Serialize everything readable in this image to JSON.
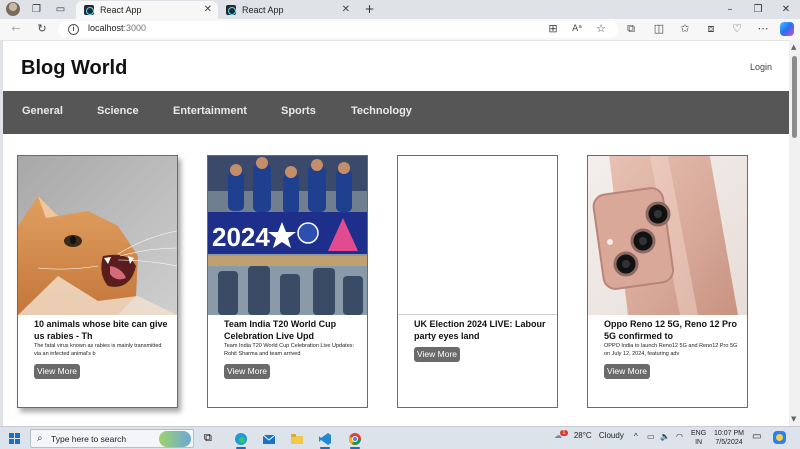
{
  "browser": {
    "tabs": [
      {
        "label": "React App",
        "active": true
      },
      {
        "label": "React App",
        "active": false
      }
    ],
    "address": {
      "host": "localhost",
      "port": ":3000"
    }
  },
  "site": {
    "brand": "Blog World",
    "login_label": "Login",
    "categories": [
      "General",
      "Science",
      "Entertainment",
      "Sports",
      "Technology"
    ],
    "cards": [
      {
        "title": "10 animals whose bite can give us rabies - Th",
        "description": "The fatal virus known as rabies is mainly transmitted via an infected animal's b",
        "button": "View More",
        "image": "cat-photo"
      },
      {
        "title": "Team India T20 World Cup Celebration Live Upd",
        "description": "Team India T20 World Cup Celebration Live Updates: Rohit Sharma and team arrived",
        "button": "View More",
        "image": "cricket-team-bus-photo",
        "banner_text": "2024"
      },
      {
        "title": "UK Election 2024 LIVE: Labour party eyes land",
        "description": "",
        "button": "View More",
        "image": ""
      },
      {
        "title": "Oppo Reno 12 5G, Reno 12 Pro 5G confirmed to",
        "description": "OPPO India to launch Reno12 5G and Reno12 Pro 5G on July 12, 2024, featuring adv",
        "button": "View More",
        "image": "pink-phone-photo"
      }
    ]
  },
  "taskbar": {
    "search_placeholder": "Type here to search",
    "weather": {
      "temp": "28°C",
      "condition": "Cloudy",
      "badge": "1"
    },
    "language": {
      "line1": "ENG",
      "line2": "IN"
    },
    "clock": {
      "time": "10:07 PM",
      "date": "7/5/2024"
    }
  },
  "colors": {
    "nav_bar": "#565656",
    "button": "#6a6a6a",
    "accent": "#1b6ec2"
  }
}
